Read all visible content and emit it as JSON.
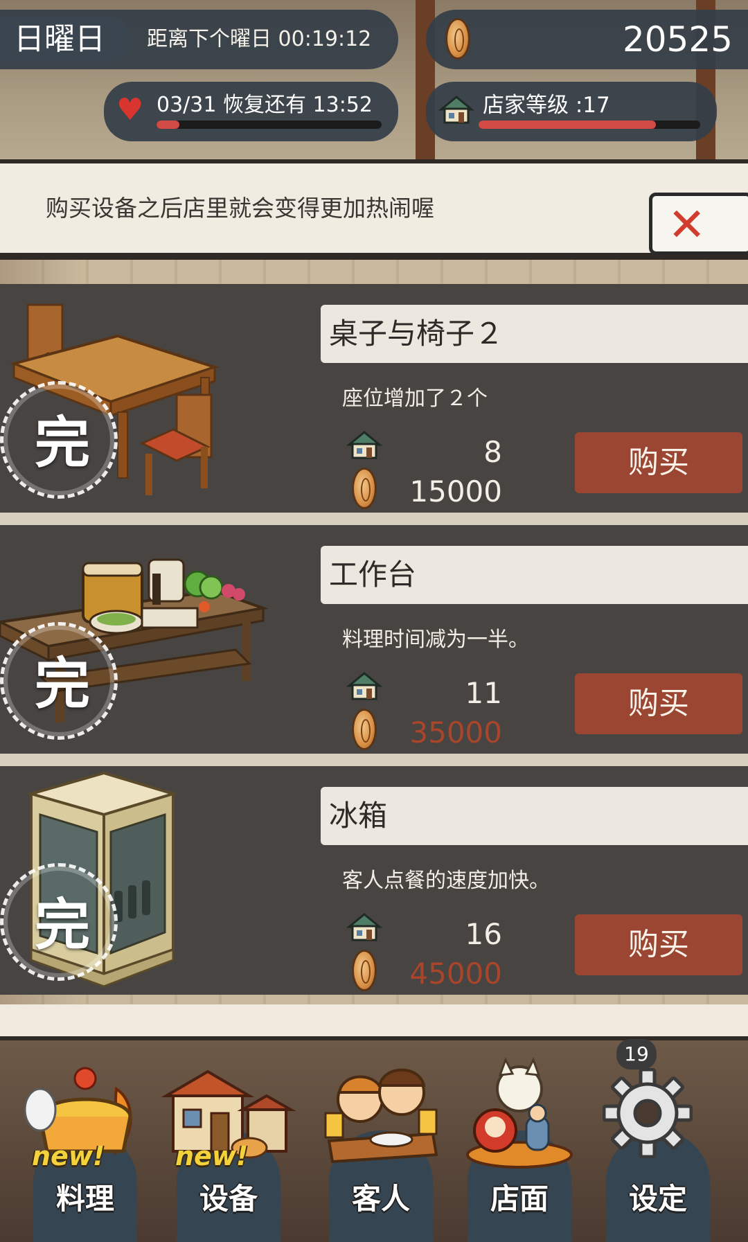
{
  "hud": {
    "day": "日曜日",
    "next_day_text": "距离下个曜日 00:19:12",
    "coins": "20525",
    "stamina_text": "03/31  恢复还有  13:52",
    "stamina_fraction": 0.1,
    "shop_level_text": "店家等级 :17",
    "shop_level_fraction": 0.8
  },
  "banner": {
    "message": "购买设备之后店里就会变得更加热闹喔",
    "close_symbol": "✕"
  },
  "items": [
    {
      "name": "桌子与椅子２",
      "description": "座位增加了２个",
      "stamp": "完",
      "level": "8",
      "price": "15000",
      "affordable": true,
      "buy_label": "购买"
    },
    {
      "name": "工作台",
      "description": "料理时间减为一半。",
      "stamp": "完",
      "level": "11",
      "price": "35000",
      "affordable": false,
      "buy_label": "购买"
    },
    {
      "name": "冰箱",
      "description": "客人点餐的速度加快。",
      "stamp": "完",
      "level": "16",
      "price": "45000",
      "affordable": false,
      "buy_label": "购买"
    }
  ],
  "nav": {
    "items": [
      {
        "label": "料理",
        "new": "new!"
      },
      {
        "label": "设备",
        "new": "new!"
      },
      {
        "label": "客人"
      },
      {
        "label": "店面"
      },
      {
        "label": "设定"
      }
    ],
    "badge": "19"
  },
  "colors": {
    "hud_pill": "#343e48",
    "card_bg": "#474442",
    "buy_button": "#9a4632",
    "price_short": "#a8452a",
    "stamina_bar": "#d24a45"
  }
}
